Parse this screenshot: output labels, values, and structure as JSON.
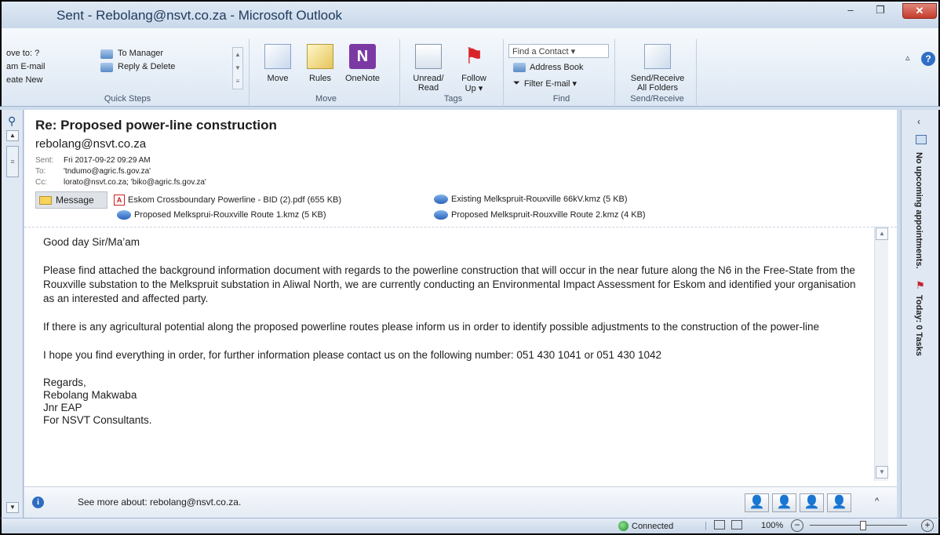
{
  "window": {
    "title": "Sent - Rebolang@nsvt.co.za  -  Microsoft Outlook",
    "min": "–",
    "max": "❐",
    "close": "✕"
  },
  "ribbon": {
    "quick_steps": {
      "left_items": [
        "ove to: ?",
        "am E-mail",
        "eate New"
      ],
      "to_manager": "To Manager",
      "reply_delete": "Reply & Delete",
      "label": "Quick Steps"
    },
    "move_group": {
      "move": "Move",
      "rules": "Rules",
      "onenote": "OneNote",
      "label": "Move"
    },
    "tags_group": {
      "unread_read_1": "Unread/",
      "unread_read_2": "Read",
      "follow_up_1": "Follow",
      "follow_up_2": "Up ▾",
      "label": "Tags"
    },
    "find_group": {
      "find_contact": "Find a Contact ▾",
      "address_book": "Address Book",
      "filter_email": "Filter E-mail ▾",
      "label": "Find"
    },
    "sendrecv_group": {
      "btn_1": "Send/Receive",
      "btn_2": "All Folders",
      "label": "Send/Receive"
    }
  },
  "message": {
    "subject": "Re: Proposed power-line construction",
    "from": "rebolang@nsvt.co.za",
    "sent_label": "Sent:",
    "sent_value": "Fri 2017-09-22 09:29 AM",
    "to_label": "To:",
    "to_value": "'tndumo@agric.fs.gov.za'",
    "cc_label": "Cc:",
    "cc_value": "lorato@nsvt.co.za; 'biko@agric.fs.gov.za'",
    "message_tab": "Message",
    "attachments": [
      "Eskom Crossboundary Powerline - BID (2).pdf (655 KB)",
      "Existing Melkspruit-Rouxville 66kV.kmz (5 KB)",
      "Proposed Melksprui-Rouxville Route 1.kmz (5 KB)",
      "Proposed Melkspruit-Rouxville Route 2.kmz (4 KB)"
    ],
    "body": {
      "greeting": "Good day Sir/Ma’am",
      "p1": "Please find attached the background information document with regards to the powerline construction that will occur in the near future along the N6 in the Free-State from the Rouxville substation to the Melkspruit substation in Aliwal North, we are currently conducting an Environmental Impact Assessment for Eskom and identified your organisation as an interested and affected party.",
      "p2": "If there is any agricultural potential along the proposed powerline routes please inform us in order to identify possible adjustments to the construction of the power-line",
      "p3": "I hope you find everything in order, for further information please contact us on the following number: 051 430 1041 or 051 430 1042",
      "sig": [
        "Regards,",
        "Rebolang Makwaba",
        "Jnr EAP",
        "For NSVT Consultants."
      ]
    }
  },
  "people_pane": {
    "see_more": "See more about: rebolang@nsvt.co.za."
  },
  "todo_bar": {
    "appointments": "No upcoming appointments.",
    "tasks": "Today: 0 Tasks"
  },
  "status": {
    "connected": "Connected",
    "zoom": "100%"
  }
}
